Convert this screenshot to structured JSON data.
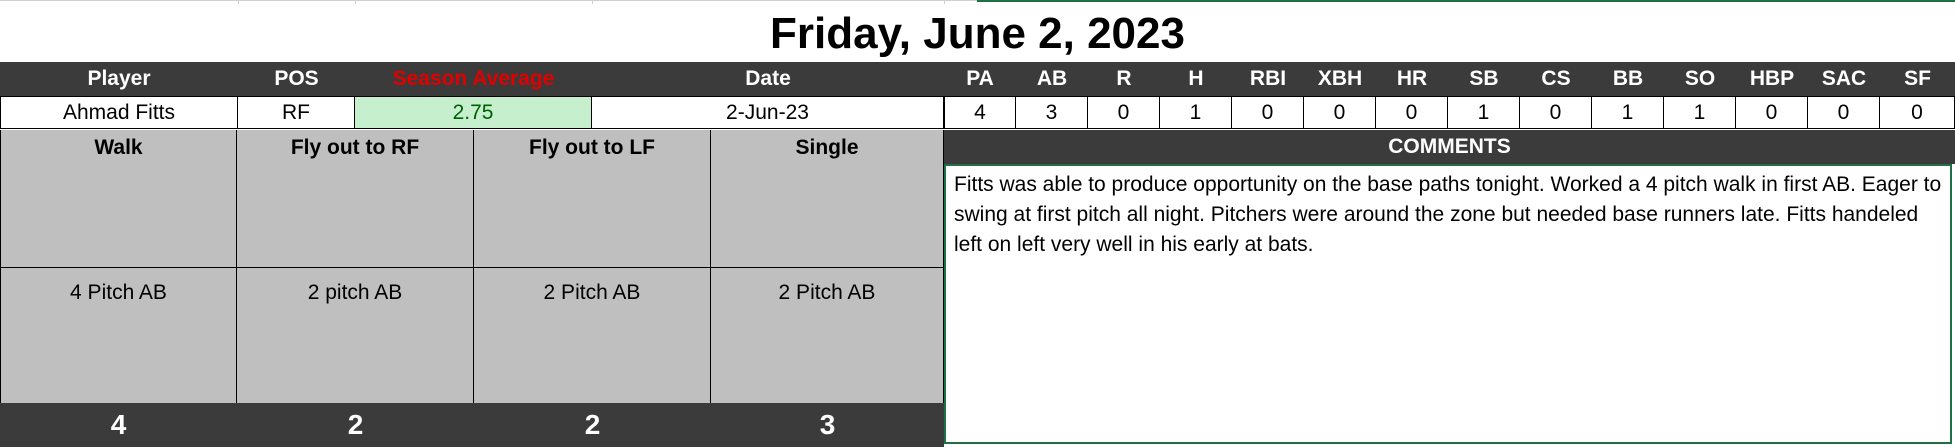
{
  "title": "Friday, June 2, 2023",
  "headers": {
    "player": "Player",
    "pos": "POS",
    "season_average": "Season Average",
    "date": "Date",
    "stats": [
      "PA",
      "AB",
      "R",
      "H",
      "RBI",
      "XBH",
      "HR",
      "SB",
      "CS",
      "BB",
      "SO",
      "HBP",
      "SAC",
      "SF"
    ]
  },
  "row": {
    "player": "Ahmad Fitts",
    "pos": "RF",
    "season_average": "2.75",
    "date": "2-Jun-23",
    "stats": [
      "4",
      "3",
      "0",
      "1",
      "0",
      "0",
      "0",
      "1",
      "0",
      "1",
      "1",
      "0",
      "0",
      "0"
    ]
  },
  "plate_appearances": [
    {
      "result": "Walk",
      "detail": "4 Pitch AB",
      "pitches": "4"
    },
    {
      "result": "Fly out to RF",
      "detail": "2 pitch AB",
      "pitches": "2"
    },
    {
      "result": "Fly out to LF",
      "detail": "2 Pitch AB",
      "pitches": "2"
    },
    {
      "result": "Single",
      "detail": "2 Pitch AB",
      "pitches": "3"
    }
  ],
  "comments": {
    "header": "COMMENTS",
    "text": "Fitts was able to produce opportunity on the base paths tonight. Worked a 4 pitch walk in first AB. Eager to swing at first pitch all night. Pitchers were around the zone but needed base runners late. Fitts handeled left on left very well in his early at bats."
  },
  "colors": {
    "header_bg": "#3b3b3b",
    "average_fill": "#c6efce",
    "average_text": "#006100",
    "season_average_header": "#e00000",
    "pa_box_fill": "#bfbfbf",
    "selection_border": "#1e7145"
  }
}
